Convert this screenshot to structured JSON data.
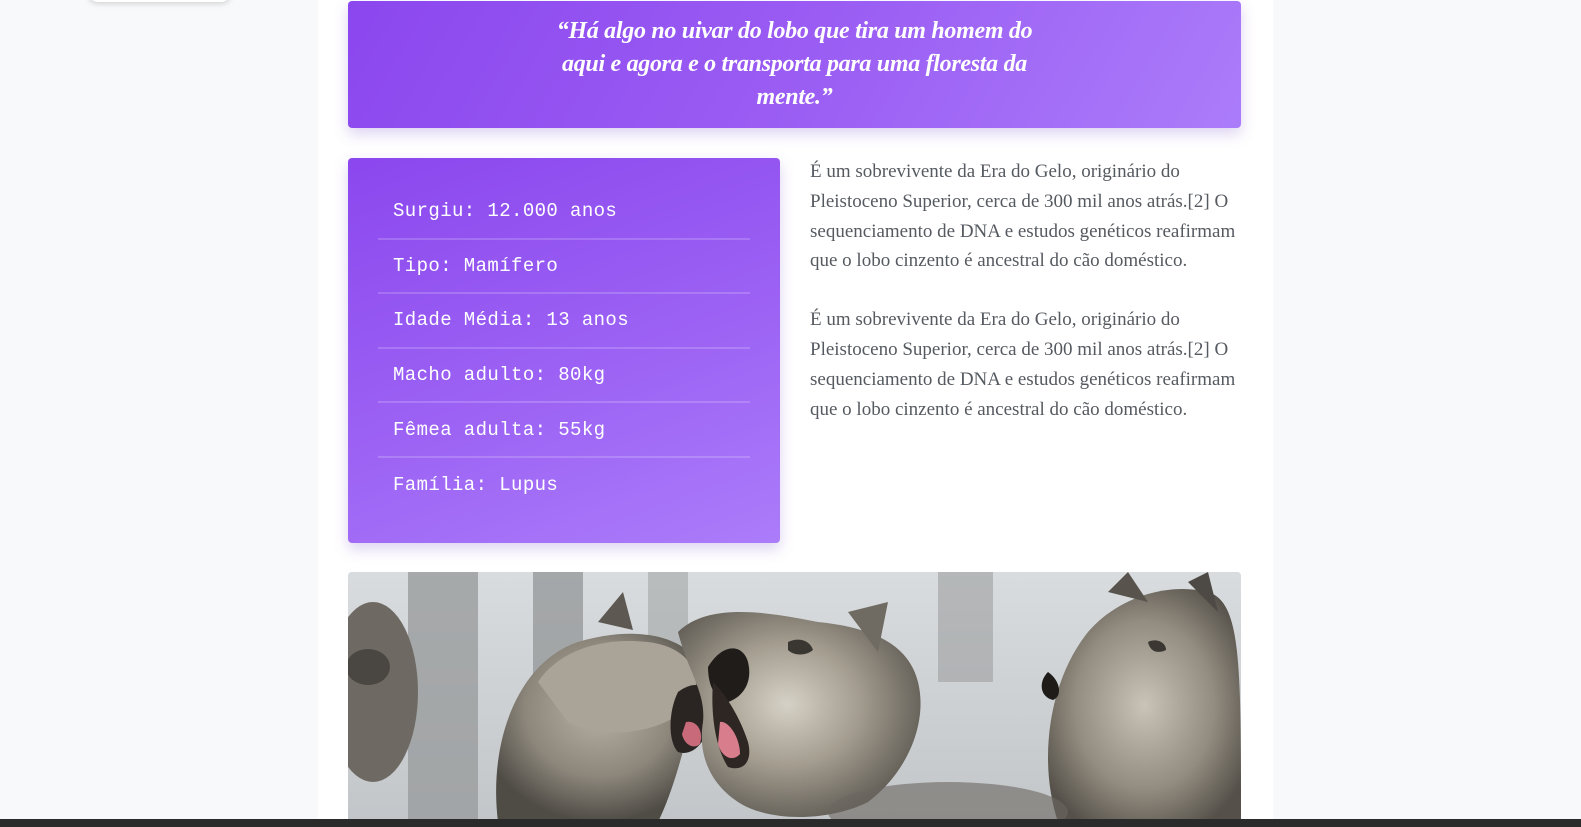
{
  "quote": {
    "text": "“Há algo no uivar do lobo que tira um homem do aqui e agora e o transporta para uma floresta da mente.”"
  },
  "facts": [
    {
      "label": "Surgiu: 12.000 anos"
    },
    {
      "label": "Tipo: Mamífero"
    },
    {
      "label": "Idade Média: 13 anos"
    },
    {
      "label": "Macho adulto: 80kg"
    },
    {
      "label": "Fêmea adulta: 55kg"
    },
    {
      "label": "Família: Lupus"
    }
  ],
  "paragraphs": [
    {
      "text": "É um sobrevivente da Era do Gelo, originário do Pleistoceno Superior, cerca de 300 mil anos atrás.[2] O sequenciamento de DNA e estudos genéticos reafirmam que o lobo cinzento é ancestral do cão doméstico."
    },
    {
      "text": "É um sobrevivente da Era do Gelo, originário do Pleistoceno Superior, cerca de 300 mil anos atrás.[2] O sequenciamento de DNA e estudos genéticos reafirmam que o lobo cinzento é ancestral do cão doméstico."
    }
  ],
  "colors": {
    "accent_start": "#8b47ee",
    "accent_end": "#ab7cfa",
    "body_text": "#555a60",
    "page_bg": "#f8f9fb"
  },
  "image": {
    "subject": "wolves-photo"
  }
}
